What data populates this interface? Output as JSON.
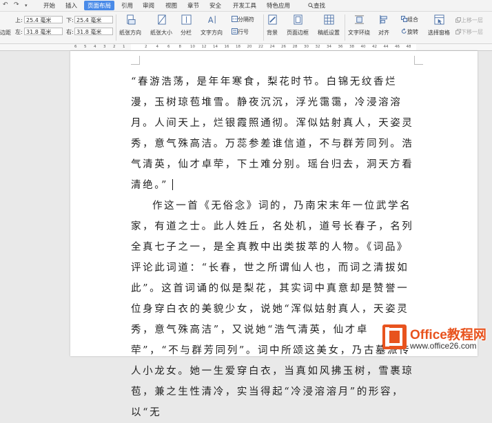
{
  "quick_access": {
    "undo": "↶",
    "redo": "↷",
    "more": "▾"
  },
  "menu": {
    "tabs": [
      "开始",
      "插入",
      "页面布局",
      "引用",
      "审阅",
      "视图",
      "章节",
      "安全",
      "开发工具",
      "特色应用"
    ],
    "active": "页面布局",
    "search_label": "查找"
  },
  "ribbon": {
    "margins": {
      "top_label": "上:",
      "top_value": "25.4 毫米",
      "bottom_label": "下:",
      "bottom_value": "25.4 毫米",
      "left_label": "左:",
      "left_value": "31.8 毫米",
      "right_label": "右:",
      "right_value": "31.8 毫米",
      "margin_button": "边距"
    },
    "tools": {
      "orientation": "纸张方向",
      "size": "纸张大小",
      "columns": "分栏",
      "text_direction": "文字方向",
      "separator": "分隔符",
      "line_number": "行号",
      "background": "背景",
      "page_border": "页面边框",
      "draft_grid": "稿纸设置",
      "text_wrap": "文字环绕",
      "align": "对齐",
      "group": "组合",
      "rotate": "旋转",
      "selection_pane": "选择窗格",
      "bring_forward": "上移一层",
      "send_backward": "下移一层"
    }
  },
  "ruler": {
    "left_ticks": [
      "6",
      "5",
      "4",
      "3",
      "2",
      "1"
    ],
    "right_ticks": [
      "2",
      "4",
      "6",
      "8",
      "10",
      "12",
      "14",
      "16",
      "18",
      "20",
      "22",
      "24",
      "26",
      "28",
      "30",
      "32",
      "34",
      "36",
      "38",
      "40",
      "42",
      "44",
      "46",
      "48"
    ]
  },
  "document": {
    "paragraphs": [
      "“春游浩荡，是年年寒食，梨花时节。白锦无纹香烂漫，玉树琼苞堆雪。静夜沉沉，浮光霭霭，冷浸溶溶月。人间天上，烂银霞照通彻。浑似姑射真人，天姿灵秀，意气殊高洁。万蕊参差谁信道，不与群芳同列。浩气清英，仙才卓荦，下土难分别。瑶台归去，洞天方看清绝。”",
      "作这一首《无俗念》词的，乃南宋末年一位武学名家，有道之士。此人姓丘，名处机，道号长春子，名列全真七子之一，是全真教中出类拔萃的人物。《词品》评论此词道：“长春，世之所谓仙人也，而词之清拔如此”。这首词诵的似是梨花，其实词中真意却是赞誉一位身穿白衣的美貌少女，说她“浑似姑射真人，天姿灵秀，意气殊高洁”，又说她“浩气清英，仙才卓荦”，“不与群芳同列”。词中所颂这美女，乃古墓派传人小龙女。她一生爱穿白衣，当真如风拂玉树，雪裹琼苞，兼之生性清冷，实当得起“冷浸溶溶月”的形容，以“无"
    ]
  },
  "watermark": {
    "title": "Office教程网",
    "url": "www.office26.com",
    "logo_color": "#e8531e"
  }
}
